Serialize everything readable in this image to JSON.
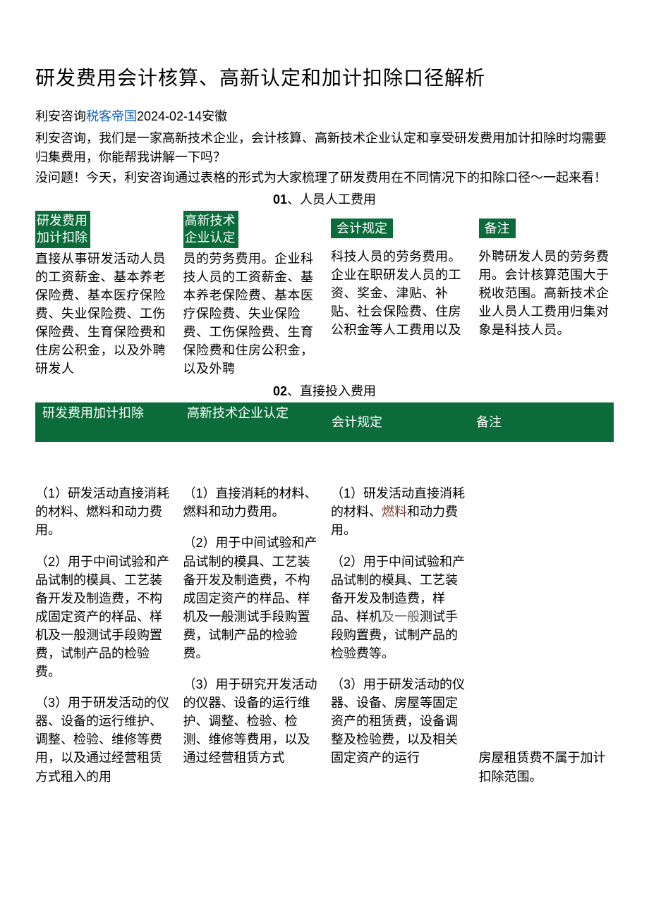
{
  "title": "研发费用会计核算、高新认定和加计扣除口径解析",
  "meta": {
    "source_prefix": "利安咨询",
    "link_text": "税客帝国",
    "date_loc": "2024-02-14安徽"
  },
  "intro": {
    "p1": "利安咨询，我们是一家高新技术企业，会计核算、高新技术企业认定和享受研发费用加计扣除时均需要归集费用，你能帮我讲解一下吗？",
    "p2": "没问题！今天，利安咨询通过表格的形式为大家梳理了研发费用在不同情况下的扣除口径～一起来看！"
  },
  "section01": {
    "num": "01",
    "title": "、人员人工费用",
    "headers": {
      "h1": "研发费用\n加计扣除",
      "h2": "高新技术\n企业认定",
      "h3": "会计规定",
      "h4": "备注"
    },
    "cells": {
      "c1": "直接从事研发活动人员的工资薪金、基本养老保险费、基本医疗保险费、失业保险费、工伤保险费、生育保险费和住房公积金，以及外聘研发人",
      "c2": "员的劳务费用。企业科技人员的工资薪金、基本养老保险费、基本医疗保险费、失业保险费、工伤保险费、生育保险费和住房公积金，以及外聘",
      "c3": "科技人员的劳务费用。企业在职研发人员的工资、奖金、津贴、补贴、社会保险费、住房公积金等人工费用以及",
      "c4": "外聘研发人员的劳务费用。会计核算范围大于税收范围。高新技术企业人员人工费用归集对象是科技人员。"
    }
  },
  "section02": {
    "num": "02",
    "title": "、直接投入费用",
    "headers": {
      "h1": "研发费用加计扣除",
      "h2": "高新技术企业认定",
      "h3": "会计规定",
      "h4": "备注"
    },
    "rows": {
      "c1p1": "（1）研发活动直接消耗的材料、燃料和动力费用。",
      "c1p2": "（2）用于中间试验和产品试制的模具、工艺装备开发及制造费，不构成固定资产的样品、样机及一般测试手段购置费，试制产品的检验费。",
      "c1p3": "（3）用于研发活动的仪器、设备的运行维护、调整、检验、维修等费用，以及通过经营租赁方式租入的用",
      "c2p1": "（1）直接消耗的材料、燃料和动力费用。",
      "c2p2": "（2）用于中间试验和产品试制的模具、工艺装备开发及制造费，不构成固定资产的样品、样机及一般测试手段购置费，试制产品的检验费。",
      "c2p3": "（3）用于研究开发活动的仪器、设备的运行维护、调整、检验、检测、维修等费用，以及通过经营租赁方式",
      "c3p1a": "（1）研发活动直接消耗的材料、",
      "c3p1b": "燃料",
      "c3p1c": "和动力费用。",
      "c3p2a": "（2）用于中间试验和产品试制的模具、工艺装备开发及制造费，样品、样机",
      "c3p2b": "及一般",
      "c3p2c": "测试手段购置费，试制产品的检验费等。",
      "c3p3": "（3）用于研发活动的仪器、设备、房屋等固定资产的租赁费，设备调整及检验费，以及相关固定资产的运行",
      "c4": "房屋租赁费不属于加计扣除范围。"
    }
  }
}
